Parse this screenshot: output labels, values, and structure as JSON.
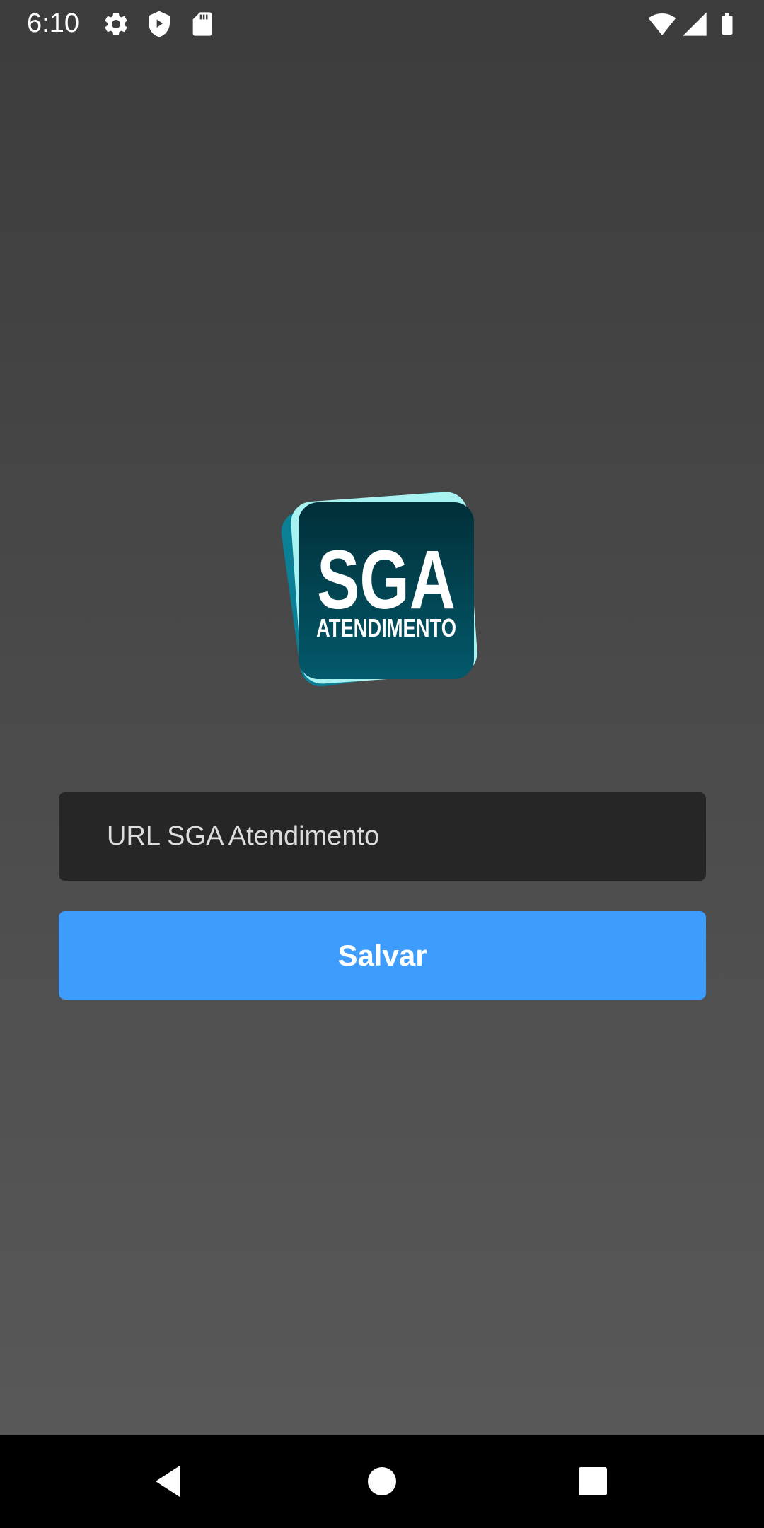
{
  "status_bar": {
    "time": "6:10",
    "icons": [
      "gear-icon",
      "shield-icon",
      "sd-card-icon",
      "wifi-icon",
      "signal-icon",
      "battery-icon"
    ]
  },
  "logo": {
    "title": "SGA",
    "subtitle": "ATENDIMENTO",
    "colors": {
      "back_card": "#0b7f95",
      "mid_card": "#a8f3f2",
      "front_top": "#012f38",
      "front_bottom": "#03596b"
    }
  },
  "form": {
    "url_placeholder": "URL SGA Atendimento",
    "url_value": "",
    "save_label": "Salvar"
  },
  "colors": {
    "accent": "#3d9cfc",
    "input_bg": "#262626"
  },
  "nav_bar": {
    "buttons": [
      "back-icon",
      "home-icon",
      "recents-icon"
    ]
  }
}
